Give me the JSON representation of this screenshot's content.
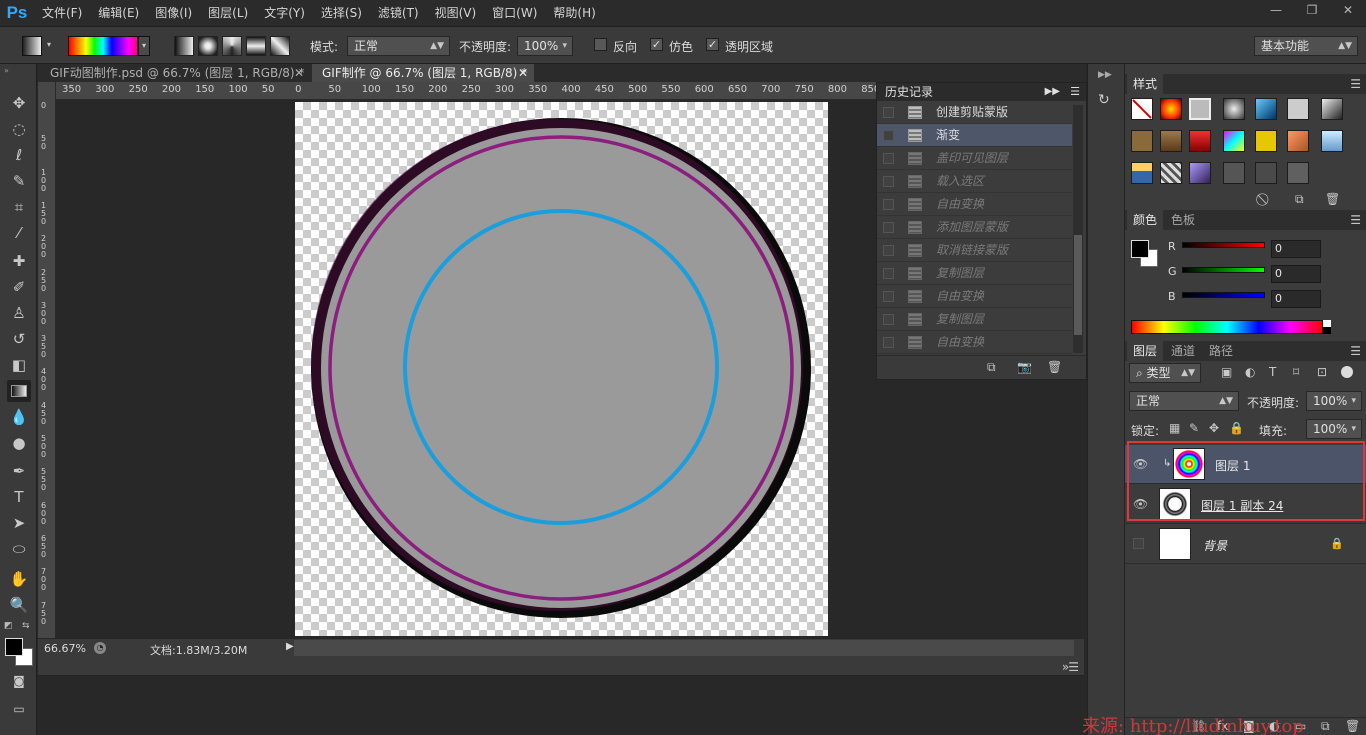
{
  "app": {
    "logo": "Ps"
  },
  "menu": [
    "文件(F)",
    "编辑(E)",
    "图像(I)",
    "图层(L)",
    "文字(Y)",
    "选择(S)",
    "滤镜(T)",
    "视图(V)",
    "窗口(W)",
    "帮助(H)"
  ],
  "window_controls": {
    "minimize": "—",
    "restore": "❐",
    "close": "✕"
  },
  "options": {
    "mode_label": "模式:",
    "mode_value": "正常",
    "opacity_label": "不透明度:",
    "opacity_value": "100%",
    "reverse_label": "反向",
    "reverse_checked": false,
    "dither_label": "仿色",
    "dither_checked": true,
    "transparency_label": "透明区域",
    "transparency_checked": true,
    "workspace": "基本功能"
  },
  "tabs": [
    {
      "label": "GIF动图制作.psd @ 66.7% (图层 1, RGB/8) *",
      "close": "✕",
      "active": false
    },
    {
      "label": "GIF制作 @ 66.7% (图层 1, RGB/8) *",
      "close": "✕",
      "active": true
    }
  ],
  "ruler": {
    "top": [
      "350",
      "300",
      "250",
      "200",
      "150",
      "100",
      "50",
      "0",
      "50",
      "100",
      "150",
      "200",
      "250",
      "300",
      "350",
      "400",
      "450",
      "500",
      "550",
      "600",
      "650",
      "700",
      "750",
      "800",
      "850"
    ],
    "left": [
      "0",
      "5 0",
      "1 0 0",
      "1 5 0",
      "2 0 0",
      "2 5 0",
      "3 0 0",
      "3 5 0",
      "4 0 0",
      "4 5 0",
      "5 0 0",
      "5 5 0",
      "6 0 0",
      "6 5 0",
      "7 0 0",
      "7 5 0"
    ]
  },
  "status": {
    "zoom": "66.67%",
    "doc": "文档:1.83M/3.20M"
  },
  "history": {
    "title": "历史记录",
    "items": [
      {
        "label": "创建剪贴蒙版",
        "state": "normal"
      },
      {
        "label": "渐变",
        "state": "selected"
      },
      {
        "label": "盖印可见图层",
        "state": "dim"
      },
      {
        "label": "载入选区",
        "state": "dim"
      },
      {
        "label": "自由变换",
        "state": "dim"
      },
      {
        "label": "添加图层蒙版",
        "state": "dim"
      },
      {
        "label": "取消链接蒙版",
        "state": "dim"
      },
      {
        "label": "复制图层",
        "state": "dim"
      },
      {
        "label": "自由变换",
        "state": "dim"
      },
      {
        "label": "复制图层",
        "state": "dim"
      },
      {
        "label": "自由变换",
        "state": "dim"
      }
    ]
  },
  "styles_panel": {
    "tab": "样式"
  },
  "color_panel": {
    "tabs": [
      "颜色",
      "色板"
    ],
    "r_label": "R",
    "g_label": "G",
    "b_label": "B",
    "r": "0",
    "g": "0",
    "b": "0"
  },
  "layers_panel": {
    "tabs": [
      "图层",
      "通道",
      "路径"
    ],
    "filter_type": "类型",
    "blend_mode": "正常",
    "opacity_label": "不透明度:",
    "opacity": "100%",
    "lock_label": "锁定:",
    "fill_label": "填充:",
    "fill": "100%",
    "layers": [
      {
        "name": "图层 1",
        "selected": true,
        "visible": true,
        "clipped": true
      },
      {
        "name": "图层 1 副本 24",
        "selected": false,
        "visible": true,
        "clipped": false
      },
      {
        "name": "背景",
        "selected": false,
        "visible": false,
        "locked": true
      }
    ]
  },
  "watermark": "来源: http://liudinhuy.top",
  "colors": {
    "highlight_box": "#e0383a",
    "accent": "#31a8ff"
  }
}
